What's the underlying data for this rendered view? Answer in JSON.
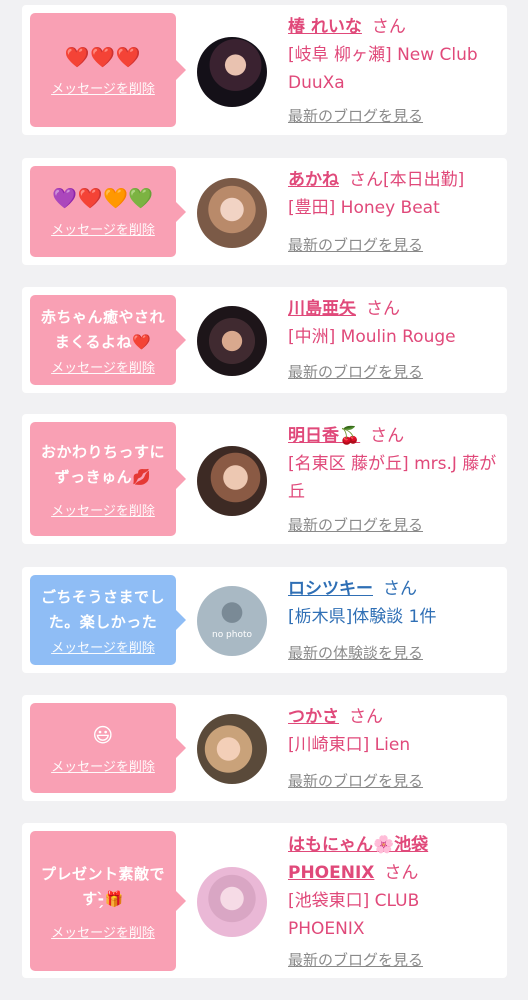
{
  "delete_label": "メッセージを削除",
  "items": [
    {
      "message": "❤️❤️❤️",
      "bubble_color": "pink",
      "name": "椿 れいな",
      "honorific": "さん",
      "name_suffix": "",
      "shop": "[岐阜 柳ヶ瀬] New Club DuuXa",
      "link": "最新のブログを見る",
      "avatar": "cast-photo"
    },
    {
      "message": "💜❤️🧡💚",
      "bubble_color": "pink",
      "name": "あかね",
      "honorific": "さん",
      "name_suffix": "[本日出勤]",
      "shop": "[豊田] Honey Beat",
      "link": "最新のブログを見る",
      "avatar": "cast-photo"
    },
    {
      "message": "赤ちゃん癒やされまくるよね❤️",
      "bubble_color": "pink",
      "name": "川島亜矢",
      "honorific": "さん",
      "name_suffix": "",
      "shop": "[中洲] Moulin Rouge",
      "link": "最新のブログを見る",
      "avatar": "cast-photo"
    },
    {
      "message": "おかわりちっすにずっきゅん💋",
      "bubble_color": "pink",
      "name": "明日香🍒",
      "honorific": "さん",
      "name_suffix": "",
      "shop": "[名東区 藤が丘] mrs.J 藤が丘",
      "link": "最新のブログを見る",
      "avatar": "cast-photo"
    },
    {
      "message": "ごちそうさまでした。楽しかった",
      "bubble_color": "blue",
      "name": "ロシツキー",
      "honorific": "さん",
      "name_suffix": "",
      "shop": "[栃木県]体験談 1件",
      "link": "最新の体験談を見る",
      "avatar": "no-photo",
      "avatar_text": "no photo"
    },
    {
      "message": "😃",
      "bubble_color": "pink",
      "name": "つかさ",
      "honorific": "さん",
      "name_suffix": "",
      "shop": "[川崎東口] Lien",
      "link": "最新のブログを見る",
      "avatar": "cast-photo"
    },
    {
      "message": "プレゼント素敵です-̗̀🎁",
      "bubble_color": "pink",
      "name": "はもにゃん🌸池袋PHOENIX",
      "honorific": "さん",
      "name_suffix": "",
      "shop": "[池袋東口] CLUB PHOENIX",
      "link": "最新のブログを見る",
      "avatar": "cast-photo"
    }
  ]
}
